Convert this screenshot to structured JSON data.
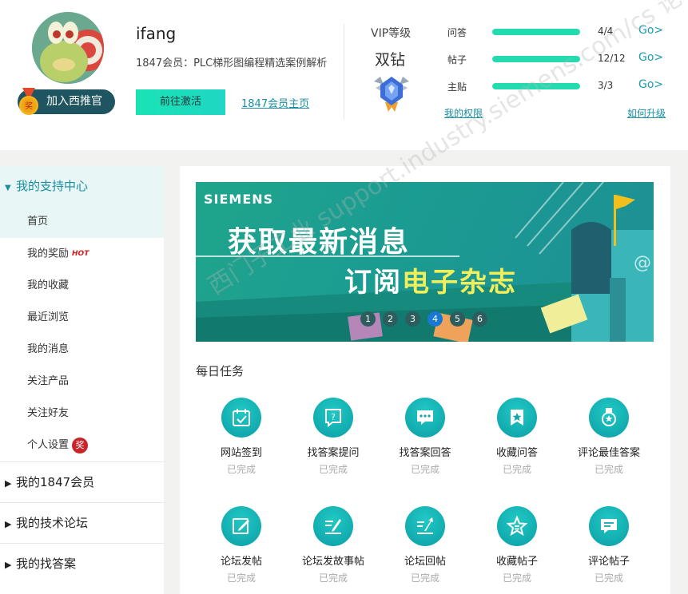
{
  "header": {
    "username": "ifang",
    "member_info": "1847会员：PLC梯形图编程精选案例解析",
    "join_button": "加入西推官",
    "medal_char": "奖",
    "activate_button": "前往激活",
    "member_home_link": "1847会员主页",
    "vip_title": "VIP等级",
    "vip_level": "双钻",
    "stats": [
      {
        "label": "问答",
        "count": "4/4",
        "progress": 1.0,
        "go": "Go>"
      },
      {
        "label": "帖子",
        "count": "12/12",
        "progress": 1.0,
        "go": "Go>"
      },
      {
        "label": "主贴",
        "count": "3/3",
        "progress": 1.0,
        "go": "Go>"
      }
    ],
    "my_rights_link": "我的权限",
    "how_upgrade_link": "如何升级"
  },
  "sidebar": {
    "support_center": "我的支持中心",
    "items": [
      {
        "label": "首页"
      },
      {
        "label": "我的奖励",
        "tag": "HOT"
      },
      {
        "label": "我的收藏"
      },
      {
        "label": "最近浏览"
      },
      {
        "label": "我的消息"
      },
      {
        "label": "关注产品"
      },
      {
        "label": "关注好友"
      },
      {
        "label": "个人设置",
        "badge": "奖"
      }
    ],
    "sections": [
      "我的1847会员",
      "我的技术论坛",
      "我的找答案"
    ]
  },
  "banner": {
    "brand": "SIEMENS",
    "line1": "获取最新消息",
    "line2a": "订阅",
    "line2b": "电子杂志",
    "dots": [
      "1",
      "2",
      "3",
      "4",
      "5",
      "6"
    ],
    "active_dot": 3,
    "watermark": "西门子工业 support.industry.siemens.com/cs 论坛"
  },
  "daily": {
    "title": "每日任务",
    "tasks": [
      {
        "name": "网站签到",
        "status": "已完成",
        "icon": "calendar-check-icon"
      },
      {
        "name": "找答案提问",
        "status": "已完成",
        "icon": "question-bubble-icon"
      },
      {
        "name": "找答案回答",
        "status": "已完成",
        "icon": "chat-dots-icon"
      },
      {
        "name": "收藏问答",
        "status": "已完成",
        "icon": "star-bookmark-icon"
      },
      {
        "name": "评论最佳答案",
        "status": "已完成",
        "icon": "medal-icon"
      },
      {
        "name": "论坛发帖",
        "status": "已完成",
        "icon": "edit-post-icon"
      },
      {
        "name": "论坛发故事帖",
        "status": "已完成",
        "icon": "story-post-icon"
      },
      {
        "name": "论坛回帖",
        "status": "已完成",
        "icon": "reply-post-icon"
      },
      {
        "name": "收藏帖子",
        "status": "已完成",
        "icon": "star-post-icon"
      },
      {
        "name": "评论帖子",
        "status": "已完成",
        "icon": "comment-post-icon"
      }
    ]
  },
  "colors": {
    "accent": "#1a8fa0",
    "progress": "#22dcb0",
    "task_icon": "#0ea7ab",
    "active_dot": "#1978d4"
  }
}
